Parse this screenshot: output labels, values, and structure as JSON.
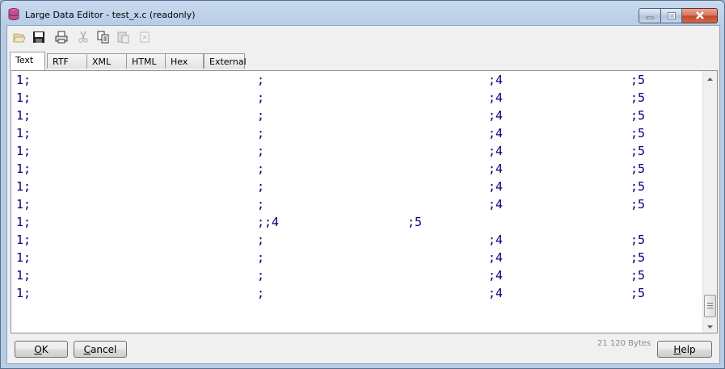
{
  "window": {
    "title": "Large Data Editor - test_x.c (readonly)",
    "icon": "database-icon"
  },
  "toolbar": {
    "icons": [
      "open-folder-icon",
      "save-icon",
      "print-icon",
      "cut-icon",
      "copy-icon",
      "paste-icon",
      "clear-icon"
    ]
  },
  "tabs": [
    {
      "label": "Text",
      "active": true
    },
    {
      "label": "RTF",
      "active": false
    },
    {
      "label": "XML",
      "active": false
    },
    {
      "label": "HTML",
      "active": false
    },
    {
      "label": "Hex",
      "active": false
    },
    {
      "label": "External",
      "active": false
    }
  ],
  "editor": {
    "lines": [
      [
        "1;",
        ";",
        ";4",
        ";5"
      ],
      [
        "1;",
        ";",
        ";4",
        ";5"
      ],
      [
        "1;",
        ";",
        ";4",
        ";5"
      ],
      [
        "1;",
        ";",
        ";4",
        ";5"
      ],
      [
        "1;",
        ";",
        ";4",
        ";5"
      ],
      [
        "1;",
        ";",
        ";4",
        ";5"
      ],
      [
        "1;",
        ";",
        ";4",
        ";5"
      ],
      [
        "1;",
        ";",
        ";4",
        ";5"
      ],
      [
        "1;",
        ";;4",
        ";5",
        ""
      ],
      [
        "1;",
        ";",
        ";4",
        ";5"
      ],
      [
        "1;",
        ";",
        ";4",
        ";5"
      ],
      [
        "1;",
        ";",
        ";4",
        ";5"
      ],
      [
        "1;",
        ";",
        ";4",
        ";5"
      ]
    ]
  },
  "footer": {
    "ok_accel": "O",
    "ok_rest": "K",
    "cancel_accel": "C",
    "cancel_rest": "ancel",
    "help_accel": "H",
    "help_rest": "elp",
    "size_text": "21 120 Bytes"
  },
  "colors": {
    "text": "#00007d",
    "title_bar": "#c9daee"
  }
}
